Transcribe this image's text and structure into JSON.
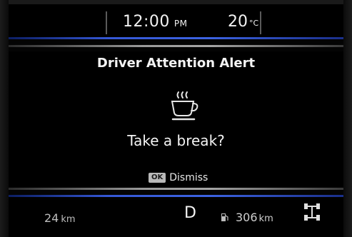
{
  "status_bar": {
    "time": "12:00",
    "ampm": "PM",
    "temperature": "20",
    "temperature_unit": "°C"
  },
  "alert": {
    "title": "Driver Attention Alert",
    "icon": "coffee-cup-icon",
    "message": "Take a break?",
    "ok_badge": "OK",
    "dismiss_label": "Dismiss"
  },
  "bottom_bar": {
    "trip_distance": "24",
    "trip_unit": "km",
    "gear": "D",
    "fuel_icon": "fuel-pump-icon",
    "range_value": "306",
    "range_unit": "km",
    "drive_icon": "all-wheel-drive-icon"
  },
  "colors": {
    "background": "#000000",
    "accent_blue": "#3c63e2",
    "divider_grey": "#9a9a9a",
    "text": "#f4f4f4"
  }
}
